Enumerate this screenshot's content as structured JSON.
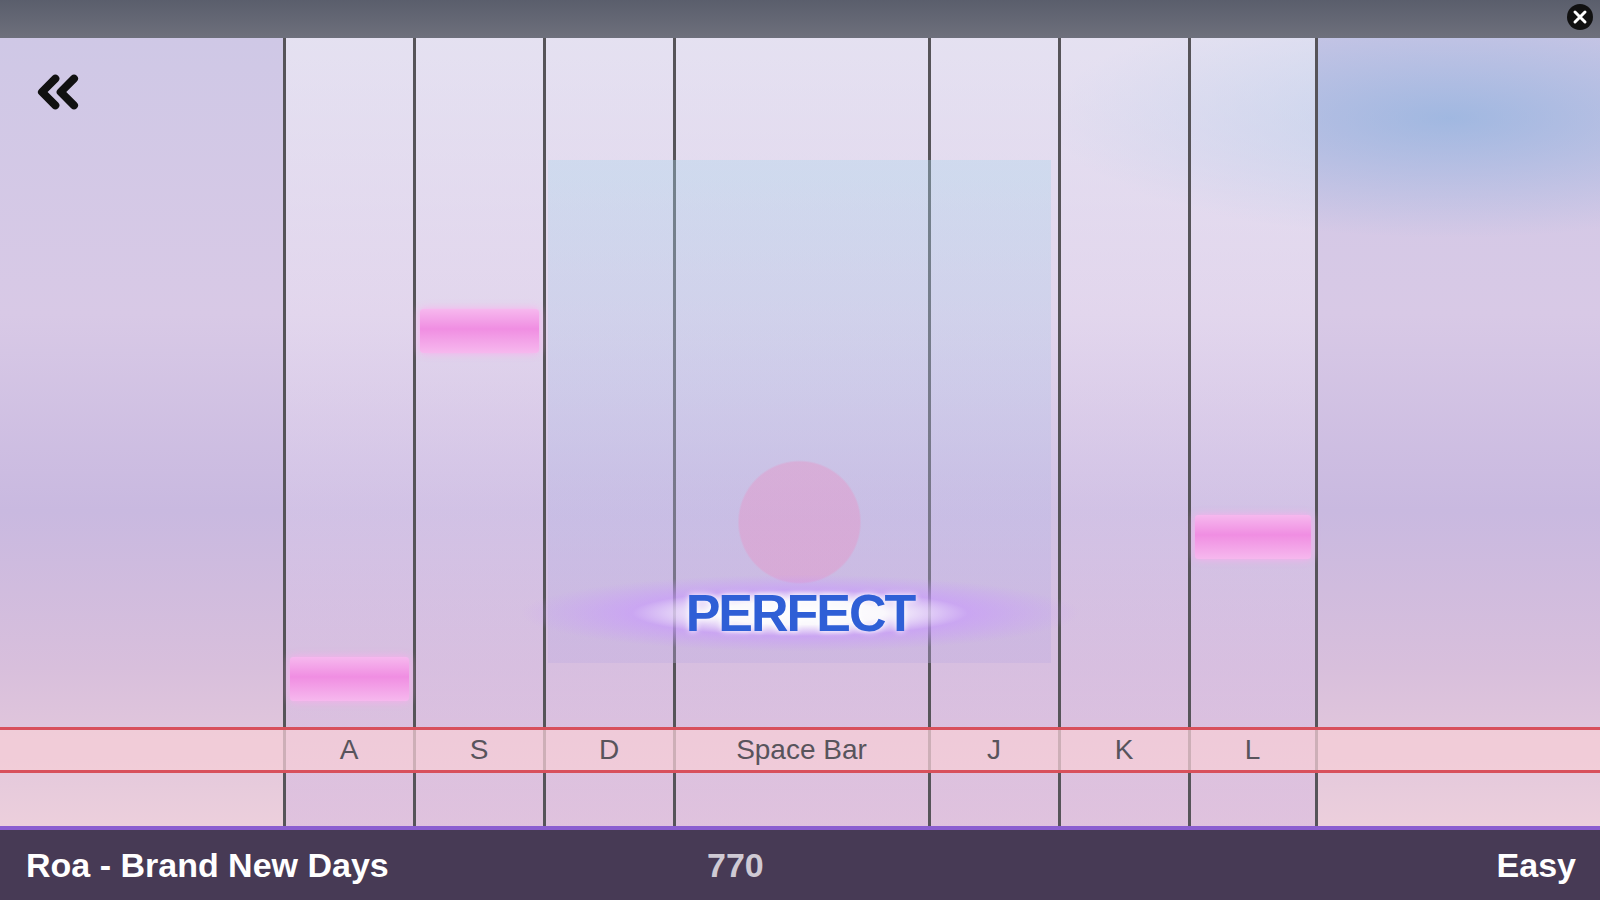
{
  "song": {
    "title": "Roa - Brand New Days",
    "score": "770",
    "difficulty": "Easy"
  },
  "judgement": "PERFECT",
  "lanes": [
    {
      "key": "A",
      "kind": "key",
      "notes": [
        {
          "progress": 0.96
        }
      ]
    },
    {
      "key": "S",
      "kind": "key",
      "notes": [
        {
          "progress": 0.42
        }
      ]
    },
    {
      "key": "D",
      "kind": "key",
      "notes": []
    },
    {
      "key": "Space Bar",
      "kind": "space",
      "notes": []
    },
    {
      "key": "J",
      "kind": "key",
      "notes": []
    },
    {
      "key": "K",
      "kind": "key",
      "notes": []
    },
    {
      "key": "L",
      "kind": "key",
      "notes": [
        {
          "progress": 0.74
        }
      ]
    }
  ]
}
